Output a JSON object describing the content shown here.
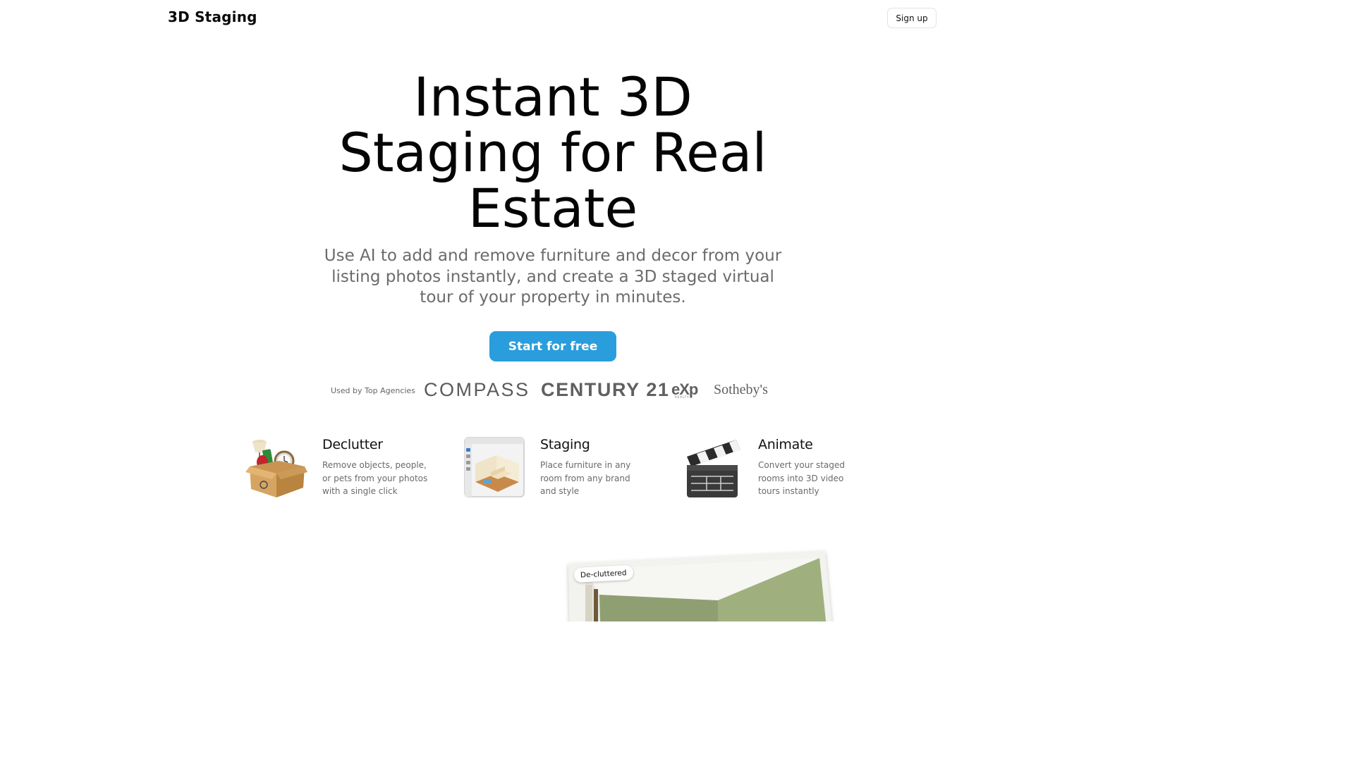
{
  "header": {
    "brand": "3D Staging",
    "signup_label": "Sign up"
  },
  "hero": {
    "title": "Instant 3D Staging for Real Estate",
    "subtitle": "Use AI to add and remove furniture and decor from your listing photos instantly, and create a 3D staged virtual tour of your property in minutes.",
    "cta_label": "Start for free"
  },
  "agencies": {
    "label": "Used by Top Agencies",
    "logos": {
      "compass": "COMPASS",
      "century21": "CENTURY 21",
      "exp": "eXp",
      "exp_sub": "REALTY",
      "sothebys": "Sotheby's"
    }
  },
  "features": [
    {
      "title": "Declutter",
      "description": "Remove objects, people, or pets from your photos with a single click",
      "icon": "cardboard-box-icon"
    },
    {
      "title": "Staging",
      "description": "Place furniture in any room from any brand and style",
      "icon": "staged-room-window-icon"
    },
    {
      "title": "Animate",
      "description": "Convert your staged rooms into 3D video tours instantly",
      "icon": "clapperboard-icon"
    }
  ],
  "preview": {
    "badge": "De-cluttered"
  },
  "colors": {
    "accent": "#2a9ddc",
    "muted_text": "#6b6b6b",
    "wall_green": "#9aac7c"
  }
}
